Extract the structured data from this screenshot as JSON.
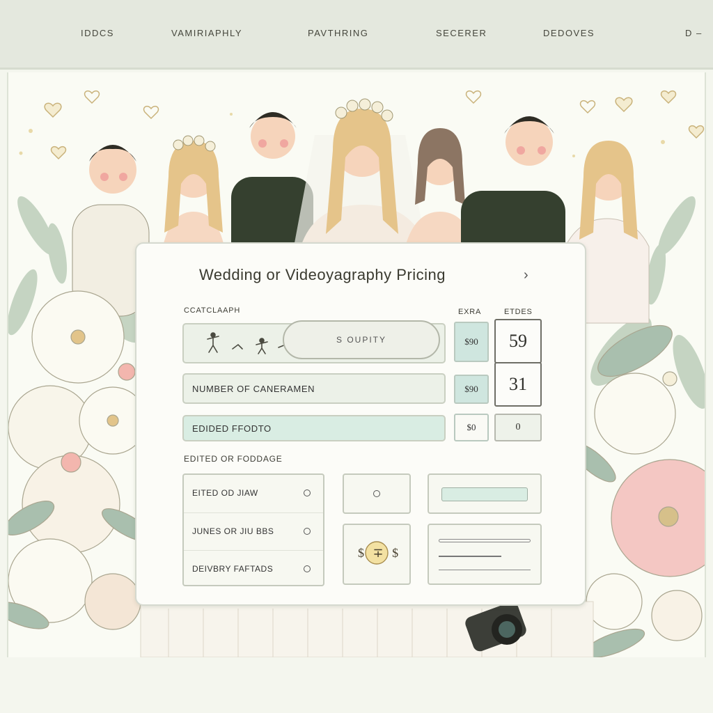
{
  "nav": {
    "items": [
      "IDDCS",
      "VAMIRIAPHLY",
      "PAVTHRING",
      "SECERER",
      "DEDOVES",
      "D –"
    ]
  },
  "card": {
    "title": "Wedding or Videoyagraphy Pricing",
    "title_chevron": "›",
    "section1_label": "CCATCLAAPH",
    "col_extra_label": "EXRA",
    "col_etdes_label": "ETDES",
    "rows": [
      {
        "label": "",
        "price": "$90",
        "value": "59"
      },
      {
        "label": "NUMBER OF CANERAMEN",
        "price": "$90",
        "value": "31"
      },
      {
        "label": "EDIDED FFODTO",
        "price": "$0",
        "value": "0"
      }
    ],
    "section2_label": "EDITED OR FODDAGE",
    "options": [
      "EITED OD JIAW",
      "JUNES OR JIU BBS",
      "DEIVBRY FAFTADS"
    ],
    "coin_text": "$ ∓ $"
  },
  "footer": {
    "button_label": "S OUPITY"
  },
  "colors": {
    "nav_bg": "#e4e8de",
    "mint": "#cfe6df",
    "blush": "#f4c7c3",
    "sage": "#a9bfae"
  }
}
